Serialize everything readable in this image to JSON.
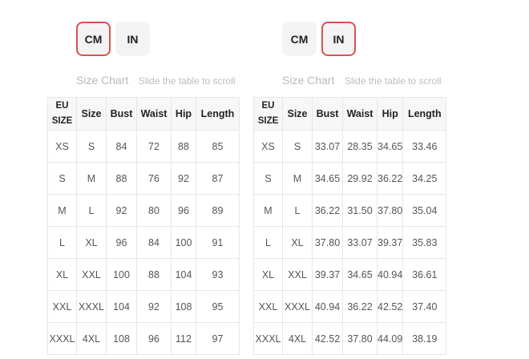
{
  "panels": [
    {
      "units": [
        "CM",
        "IN"
      ],
      "active_unit": "CM",
      "title": "Size Chart",
      "subtitle": "Slide the table to scroll",
      "headers": [
        "EU SIZE",
        "Size",
        "Bust",
        "Waist",
        "Hip",
        "Length"
      ],
      "rows": [
        [
          "XS",
          "S",
          "84",
          "72",
          "88",
          "85"
        ],
        [
          "S",
          "M",
          "88",
          "76",
          "92",
          "87"
        ],
        [
          "M",
          "L",
          "92",
          "80",
          "96",
          "89"
        ],
        [
          "L",
          "XL",
          "96",
          "84",
          "100",
          "91"
        ],
        [
          "XL",
          "XXL",
          "100",
          "88",
          "104",
          "93"
        ],
        [
          "XXL",
          "XXXL",
          "104",
          "92",
          "108",
          "95"
        ],
        [
          "XXXL",
          "4XL",
          "108",
          "96",
          "112",
          "97"
        ]
      ]
    },
    {
      "units": [
        "CM",
        "IN"
      ],
      "active_unit": "IN",
      "title": "Size Chart",
      "subtitle": "Slide the table to scroll",
      "headers": [
        "EU SIZE",
        "Size",
        "Bust",
        "Waist",
        "Hip",
        "Length"
      ],
      "rows": [
        [
          "XS",
          "S",
          "33.07",
          "28.35",
          "34.65",
          "33.46"
        ],
        [
          "S",
          "M",
          "34.65",
          "29.92",
          "36.22",
          "34.25"
        ],
        [
          "M",
          "L",
          "36.22",
          "31.50",
          "37.80",
          "35.04"
        ],
        [
          "L",
          "XL",
          "37.80",
          "33.07",
          "39.37",
          "35.83"
        ],
        [
          "XL",
          "XXL",
          "39.37",
          "34.65",
          "40.94",
          "36.61"
        ],
        [
          "XXL",
          "XXXL",
          "40.94",
          "36.22",
          "42.52",
          "37.40"
        ],
        [
          "XXXL",
          "4XL",
          "42.52",
          "37.80",
          "44.09",
          "38.19"
        ]
      ]
    }
  ]
}
